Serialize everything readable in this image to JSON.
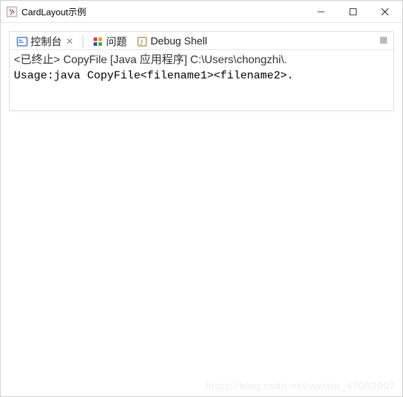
{
  "window": {
    "title": "CardLayout示例"
  },
  "tabs": {
    "console": "控制台",
    "problems": "问题",
    "debug": "Debug Shell"
  },
  "console": {
    "status": "<已终止> CopyFile [Java 应用程序] C:\\Users\\chongzhi\\.",
    "output": "Usage:java CopyFile<filename1><filename2>."
  },
  "watermark": "https://blog.csdn.net/weixin_47062907"
}
